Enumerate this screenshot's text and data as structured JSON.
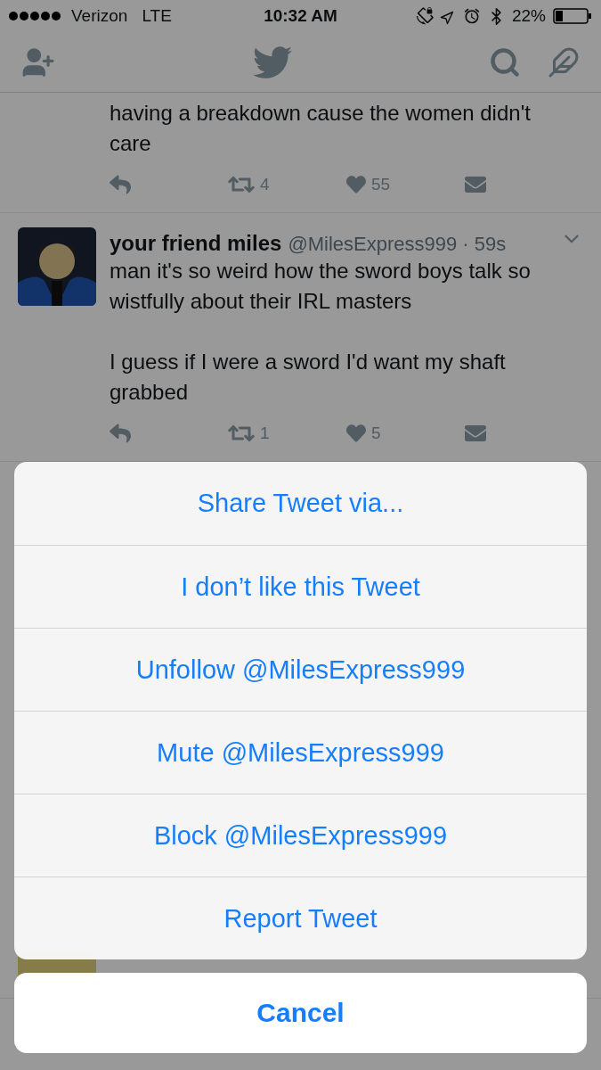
{
  "status_bar": {
    "carrier": "Verizon",
    "network": "LTE",
    "time": "10:32 AM",
    "battery": "22%"
  },
  "tweets": [
    {
      "kind": "partial",
      "paragraphs": [
        "having a breakdown cause the women didn't care"
      ],
      "retweets": "4",
      "likes": "55"
    },
    {
      "kind": "full",
      "name": "your friend miles",
      "meta": "@MilesExpress999 · 59s",
      "paragraphs": [
        "man it's so weird how the sword boys talk so wistfully about their IRL masters",
        "I guess if I were a sword I'd want my shaft grabbed"
      ],
      "retweets": "1",
      "likes": "5"
    },
    {
      "kind": "header"
    }
  ],
  "action_sheet": {
    "options": [
      "Share Tweet via...",
      "I don’t like this Tweet",
      "Unfollow @MilesExpress999",
      "Mute @MilesExpress999",
      "Block @MilesExpress999",
      "Report Tweet"
    ],
    "cancel": "Cancel"
  }
}
